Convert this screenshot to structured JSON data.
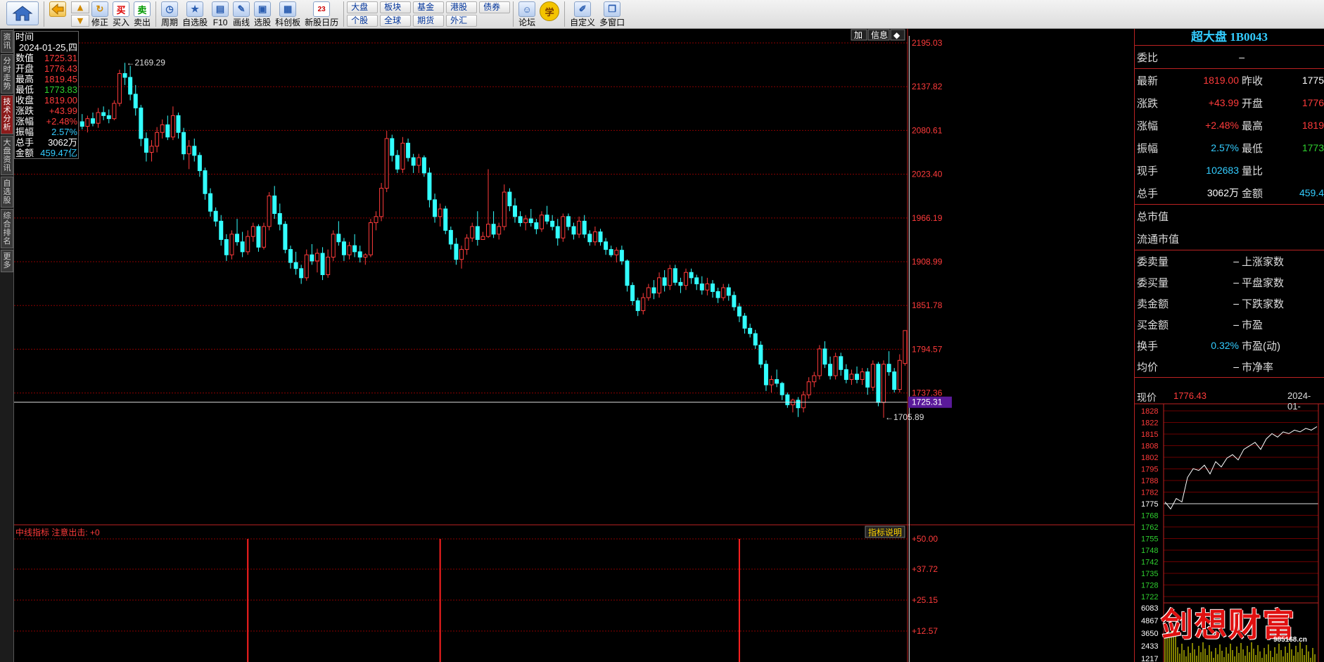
{
  "toolbar": {
    "buttons": [
      {
        "label": "修正"
      },
      {
        "label": "买入"
      },
      {
        "label": "卖出"
      },
      {
        "label": "周期"
      },
      {
        "label": "自选股"
      },
      {
        "label": "F10"
      },
      {
        "label": "画线"
      },
      {
        "label": "选股"
      },
      {
        "label": "科创板"
      },
      {
        "label": "新股日历"
      },
      {
        "label": "论坛"
      },
      {
        "label": "自定义"
      },
      {
        "label": "多窗口"
      }
    ],
    "mini_buttons": {
      "dapan": "大盘",
      "gegu": "个股",
      "bankuai": "板块",
      "quanqiu": "全球",
      "jijin": "基金",
      "qihuo": "期货",
      "ganggu": "港股",
      "waihui": "外汇",
      "zhaiquan": "债券"
    },
    "buy_glyph": "买",
    "sell_glyph": "卖",
    "learn_glyph": "学",
    "calendar_day": "23"
  },
  "side_tabs": [
    "资讯",
    "分时走势",
    "技术分析",
    "大盘资讯",
    "自选股",
    "综合排名",
    "更多"
  ],
  "active_side_tab": 2,
  "infobox": {
    "rows": [
      {
        "label": "时间",
        "value": "",
        "cls": "w"
      },
      {
        "label": "",
        "value": "2024-01-25,四",
        "cls": "w"
      },
      {
        "label": "数值",
        "value": "1725.31",
        "cls": ""
      },
      {
        "label": "开盘",
        "value": "1776.43",
        "cls": ""
      },
      {
        "label": "最高",
        "value": "1819.45",
        "cls": ""
      },
      {
        "label": "最低",
        "value": "1773.83",
        "cls": "g"
      },
      {
        "label": "收盘",
        "value": "1819.00",
        "cls": ""
      },
      {
        "label": "涨跌",
        "value": "+43.99",
        "cls": ""
      },
      {
        "label": "涨幅",
        "value": "+2.48%",
        "cls": ""
      },
      {
        "label": "振幅",
        "value": "2.57%",
        "cls": "c"
      },
      {
        "label": "总手",
        "value": "3062万",
        "cls": "w"
      },
      {
        "label": "金额",
        "value": "459.47亿",
        "cls": "c"
      }
    ]
  },
  "chart_top_buttons": {
    "add": "加",
    "info": "信息",
    "icon": "◆"
  },
  "chart_data": [
    {
      "type": "candlestick",
      "price_axis_ticks": [
        "2195.03",
        "2137.82",
        "2080.61",
        "2023.40",
        "1966.19",
        "1908.99",
        "1851.78",
        "1794.57",
        "1737.36"
      ],
      "ylim": [
        1680,
        2195.03
      ],
      "crosshair_price": "1725.31",
      "high_marker": "2169.29",
      "low_marker": "1705.89",
      "candles": [
        [
          2072,
          2082,
          2060,
          2078
        ],
        [
          2078,
          2090,
          2068,
          2074
        ],
        [
          2074,
          2098,
          2070,
          2092
        ],
        [
          2092,
          2102,
          2082,
          2086
        ],
        [
          2086,
          2100,
          2078,
          2096
        ],
        [
          2096,
          2104,
          2086,
          2090
        ],
        [
          2090,
          2110,
          2084,
          2104
        ],
        [
          2104,
          2112,
          2094,
          2100
        ],
        [
          2100,
          2108,
          2090,
          2096
        ],
        [
          2096,
          2120,
          2094,
          2116
        ],
        [
          2116,
          2160,
          2112,
          2155
        ],
        [
          2155,
          2169,
          2140,
          2150
        ],
        [
          2150,
          2165,
          2120,
          2128
        ],
        [
          2128,
          2140,
          2100,
          2110
        ],
        [
          2110,
          2114,
          2060,
          2070
        ],
        [
          2070,
          2078,
          2040,
          2052
        ],
        [
          2052,
          2068,
          2040,
          2060
        ],
        [
          2060,
          2085,
          2052,
          2078
        ],
        [
          2078,
          2095,
          2070,
          2088
        ],
        [
          2088,
          2100,
          2068,
          2072
        ],
        [
          2072,
          2112,
          2068,
          2100
        ],
        [
          2100,
          2104,
          2070,
          2078
        ],
        [
          2078,
          2084,
          2042,
          2050
        ],
        [
          2050,
          2068,
          2030,
          2060
        ],
        [
          2060,
          2070,
          2040,
          2048
        ],
        [
          2048,
          2052,
          2020,
          2028
        ],
        [
          2028,
          2032,
          1990,
          1998
        ],
        [
          1998,
          2005,
          1968,
          1975
        ],
        [
          1975,
          1980,
          1955,
          1962
        ],
        [
          1962,
          1970,
          1930,
          1938
        ],
        [
          1938,
          1945,
          1910,
          1918
        ],
        [
          1918,
          1950,
          1912,
          1945
        ],
        [
          1945,
          1965,
          1930,
          1935
        ],
        [
          1935,
          1948,
          1915,
          1922
        ],
        [
          1922,
          1950,
          1918,
          1942
        ],
        [
          1942,
          1960,
          1935,
          1955
        ],
        [
          1955,
          1958,
          1922,
          1928
        ],
        [
          1928,
          1960,
          1925,
          1955
        ],
        [
          1955,
          2000,
          1950,
          1995
        ],
        [
          1995,
          2008,
          1965,
          1972
        ],
        [
          1972,
          1985,
          1950,
          1958
        ],
        [
          1958,
          1962,
          1920,
          1925
        ],
        [
          1925,
          1930,
          1900,
          1908
        ],
        [
          1908,
          1922,
          1892,
          1900
        ],
        [
          1900,
          1905,
          1880,
          1888
        ],
        [
          1888,
          1925,
          1884,
          1918
        ],
        [
          1918,
          1932,
          1905,
          1910
        ],
        [
          1910,
          1926,
          1895,
          1920
        ],
        [
          1920,
          1928,
          1885,
          1892
        ],
        [
          1892,
          1925,
          1888,
          1915
        ],
        [
          1915,
          1950,
          1910,
          1945
        ],
        [
          1945,
          1962,
          1930,
          1935
        ],
        [
          1935,
          1940,
          1910,
          1918
        ],
        [
          1918,
          1935,
          1912,
          1930
        ],
        [
          1930,
          1945,
          1915,
          1922
        ],
        [
          1922,
          1930,
          1908,
          1915
        ],
        [
          1915,
          1920,
          1905,
          1918
        ],
        [
          1918,
          1965,
          1915,
          1960
        ],
        [
          1960,
          1975,
          1950,
          1968
        ],
        [
          1968,
          2012,
          1962,
          2005
        ],
        [
          2005,
          2080,
          2000,
          2070
        ],
        [
          2070,
          2075,
          2040,
          2048
        ],
        [
          2048,
          2055,
          2025,
          2030
        ],
        [
          2030,
          2072,
          2025,
          2064
        ],
        [
          2064,
          2070,
          2040,
          2045
        ],
        [
          2045,
          2050,
          2025,
          2035
        ],
        [
          2035,
          2050,
          2025,
          2045
        ],
        [
          2045,
          2048,
          2020,
          2025
        ],
        [
          2025,
          2032,
          1980,
          1990
        ],
        [
          1990,
          1998,
          1960,
          1968
        ],
        [
          1968,
          1985,
          1955,
          1978
        ],
        [
          1978,
          1982,
          1945,
          1950
        ],
        [
          1950,
          1955,
          1925,
          1932
        ],
        [
          1932,
          1940,
          1905,
          1912
        ],
        [
          1912,
          1930,
          1900,
          1925
        ],
        [
          1925,
          1945,
          1918,
          1940
        ],
        [
          1940,
          1960,
          1935,
          1955
        ],
        [
          1955,
          1975,
          1930,
          1938
        ],
        [
          1938,
          1948,
          1940,
          1942
        ],
        [
          1942,
          2030,
          1940,
          1958
        ],
        [
          1958,
          1975,
          1940,
          1945
        ],
        [
          1945,
          1960,
          1938,
          1955
        ],
        [
          1955,
          2010,
          1950,
          2000
        ],
        [
          2000,
          2005,
          1975,
          1982
        ],
        [
          1982,
          1992,
          1960,
          1968
        ],
        [
          1968,
          1975,
          1955,
          1960
        ],
        [
          1960,
          1970,
          1950,
          1965
        ],
        [
          1965,
          1978,
          1955,
          1960
        ],
        [
          1960,
          1965,
          1945,
          1952
        ],
        [
          1952,
          1975,
          1948,
          1970
        ],
        [
          1970,
          1982,
          1958,
          1962
        ],
        [
          1962,
          1970,
          1950,
          1955
        ],
        [
          1955,
          1965,
          1930,
          1940
        ],
        [
          1940,
          1972,
          1935,
          1968
        ],
        [
          1968,
          1972,
          1950,
          1955
        ],
        [
          1955,
          1960,
          1938,
          1945
        ],
        [
          1945,
          1968,
          1940,
          1962
        ],
        [
          1962,
          1970,
          1940,
          1945
        ],
        [
          1945,
          1950,
          1930,
          1935
        ],
        [
          1935,
          1955,
          1930,
          1948
        ],
        [
          1948,
          1952,
          1930,
          1935
        ],
        [
          1935,
          1940,
          1918,
          1925
        ],
        [
          1925,
          1930,
          1915,
          1918
        ],
        [
          1918,
          1928,
          1908,
          1924
        ],
        [
          1924,
          1930,
          1905,
          1910
        ],
        [
          1910,
          1912,
          1870,
          1878
        ],
        [
          1878,
          1882,
          1852,
          1858
        ],
        [
          1858,
          1862,
          1838,
          1845
        ],
        [
          1845,
          1868,
          1840,
          1862
        ],
        [
          1862,
          1880,
          1858,
          1875
        ],
        [
          1875,
          1885,
          1860,
          1868
        ],
        [
          1868,
          1895,
          1862,
          1888
        ],
        [
          1888,
          1898,
          1870,
          1878
        ],
        [
          1878,
          1905,
          1872,
          1900
        ],
        [
          1900,
          1905,
          1878,
          1882
        ],
        [
          1882,
          1888,
          1868,
          1878
        ],
        [
          1878,
          1900,
          1872,
          1895
        ],
        [
          1895,
          1900,
          1880,
          1888
        ],
        [
          1888,
          1892,
          1872,
          1880
        ],
        [
          1880,
          1890,
          1866,
          1872
        ],
        [
          1872,
          1888,
          1865,
          1880
        ],
        [
          1880,
          1885,
          1862,
          1870
        ],
        [
          1870,
          1875,
          1855,
          1862
        ],
        [
          1862,
          1880,
          1858,
          1875
        ],
        [
          1875,
          1880,
          1858,
          1865
        ],
        [
          1865,
          1870,
          1845,
          1850
        ],
        [
          1850,
          1855,
          1830,
          1838
        ],
        [
          1838,
          1842,
          1815,
          1822
        ],
        [
          1822,
          1828,
          1810,
          1815
        ],
        [
          1815,
          1820,
          1795,
          1800
        ],
        [
          1800,
          1805,
          1770,
          1775
        ],
        [
          1775,
          1780,
          1740,
          1748
        ],
        [
          1748,
          1760,
          1738,
          1755
        ],
        [
          1755,
          1768,
          1745,
          1750
        ],
        [
          1750,
          1752,
          1728,
          1735
        ],
        [
          1735,
          1738,
          1718,
          1722
        ],
        [
          1722,
          1730,
          1712,
          1728
        ],
        [
          1728,
          1732,
          1706,
          1718
        ],
        [
          1718,
          1740,
          1712,
          1735
        ],
        [
          1735,
          1758,
          1730,
          1752
        ],
        [
          1752,
          1765,
          1745,
          1760
        ],
        [
          1760,
          1800,
          1755,
          1795
        ],
        [
          1795,
          1805,
          1770,
          1775
        ],
        [
          1775,
          1785,
          1755,
          1760
        ],
        [
          1760,
          1790,
          1755,
          1785
        ],
        [
          1785,
          1790,
          1760,
          1768
        ],
        [
          1768,
          1775,
          1750,
          1755
        ],
        [
          1755,
          1768,
          1748,
          1762
        ],
        [
          1762,
          1772,
          1750,
          1755
        ],
        [
          1755,
          1770,
          1748,
          1765
        ],
        [
          1765,
          1770,
          1735,
          1745
        ],
        [
          1745,
          1780,
          1740,
          1775
        ],
        [
          1775,
          1778,
          1720,
          1725
        ],
        [
          1725,
          1780,
          1705,
          1775
        ],
        [
          1775,
          1792,
          1760,
          1765
        ],
        [
          1765,
          1770,
          1738,
          1742
        ],
        [
          1742,
          1788,
          1738,
          1780
        ],
        [
          1776,
          1819,
          1773,
          1819
        ]
      ]
    },
    {
      "type": "bar",
      "name": "中线指标",
      "label": "中线指标 注意出击: +0",
      "axis_ticks": [
        "+50.00",
        "+37.72",
        "+25.15",
        "+12.57"
      ],
      "ylim": [
        0,
        50
      ],
      "spike_positions": [
        34,
        70,
        126
      ],
      "spike_value": 50
    }
  ],
  "indicator_button": "指标说明",
  "right_panel": {
    "title": "超大盘 1B0043",
    "weibi_label": "委比",
    "weibi_value": "–",
    "rows": [
      {
        "l1": "最新",
        "v1": "1819.00",
        "c1": "",
        "l2": "昨收",
        "v2": "1775",
        "c2": "c-white"
      },
      {
        "l1": "涨跌",
        "v1": "+43.99",
        "c1": "",
        "l2": "开盘",
        "v2": "1776",
        "c2": ""
      },
      {
        "l1": "涨幅",
        "v1": "+2.48%",
        "c1": "",
        "l2": "最高",
        "v2": "1819",
        "c2": ""
      },
      {
        "l1": "振幅",
        "v1": "2.57%",
        "c1": "c-cyan",
        "l2": "最低",
        "v2": "1773",
        "c2": "c-green"
      },
      {
        "l1": "现手",
        "v1": "102683",
        "c1": "c-cyan",
        "l2": "量比",
        "v2": "",
        "c2": ""
      },
      {
        "l1": "总手",
        "v1": "3062万",
        "c1": "c-white",
        "l2": "金额",
        "v2": "459.4",
        "c2": "c-cyan"
      }
    ],
    "mkt": [
      {
        "l": "总市值",
        "v": ""
      },
      {
        "l": "流通市值",
        "v": ""
      }
    ],
    "stats": [
      {
        "l1": "委卖量",
        "v1": "–",
        "c1": "c-white",
        "l2": "上涨家数",
        "v2": ""
      },
      {
        "l1": "委买量",
        "v1": "–",
        "c1": "c-white",
        "l2": "平盘家数",
        "v2": ""
      },
      {
        "l1": "卖金额",
        "v1": "–",
        "c1": "c-white",
        "l2": "下跌家数",
        "v2": ""
      },
      {
        "l1": "买金额",
        "v1": "–",
        "c1": "c-white",
        "l2": "市盈",
        "v2": ""
      },
      {
        "l1": "换手",
        "v1": "0.32%",
        "c1": "c-cyan",
        "l2": "市盈(动)",
        "v2": ""
      },
      {
        "l1": "均价",
        "v1": "–",
        "c1": "c-white",
        "l2": "市净率",
        "v2": ""
      }
    ],
    "mini": {
      "now_label": "现价",
      "now_value": "1776.43",
      "date": "2024-01-",
      "price_ticks": [
        "1828",
        "1822",
        "1815",
        "1808",
        "1802",
        "1795",
        "1788",
        "1782",
        "1775",
        "1768",
        "1762",
        "1755",
        "1748",
        "1742",
        "1735",
        "1728",
        "1722"
      ],
      "vol_ticks": [
        "6083",
        "4867",
        "3650",
        "2433",
        "1217"
      ],
      "watermark": "剑想财富",
      "watermark_url": "985168.cn"
    }
  }
}
